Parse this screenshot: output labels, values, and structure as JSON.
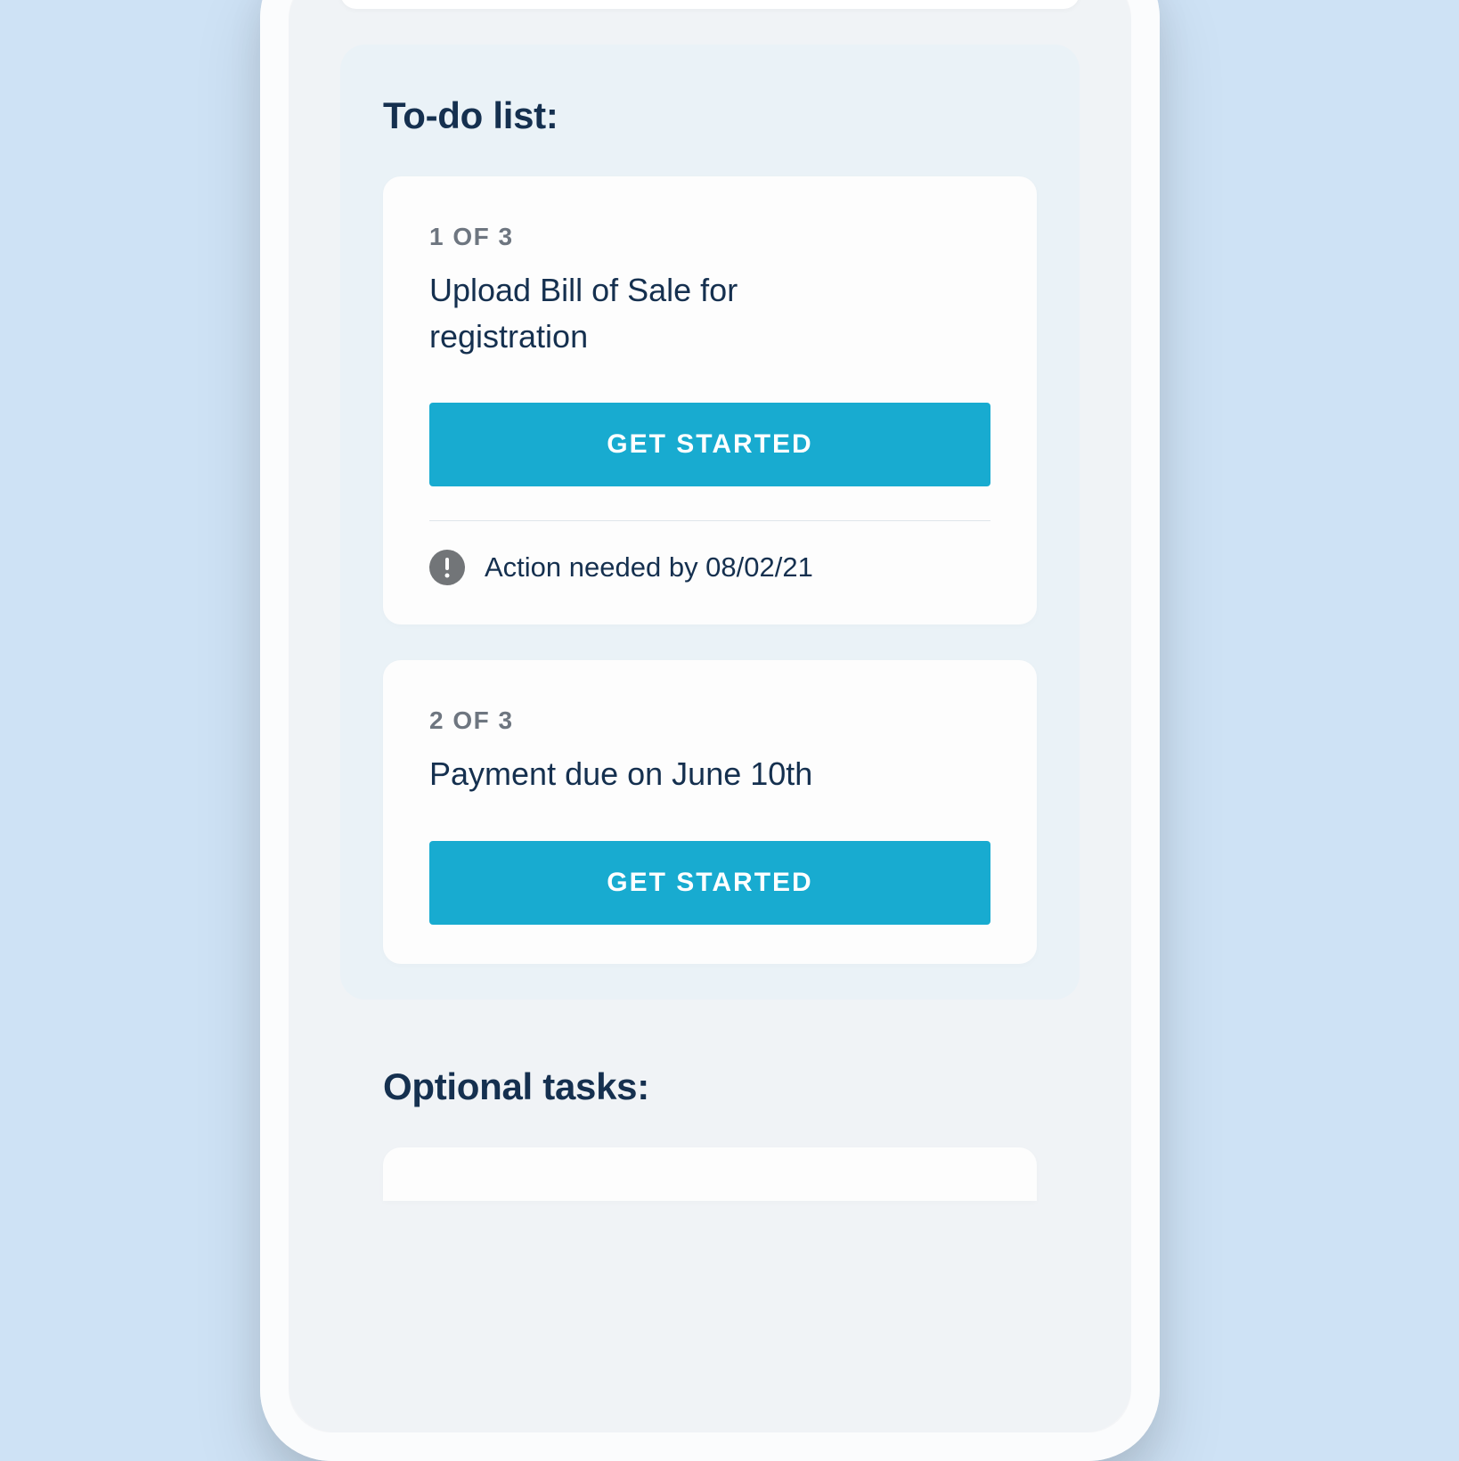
{
  "todo": {
    "heading": "To-do list:",
    "tasks": [
      {
        "counter": "1 OF 3",
        "title": "Upload Bill of Sale for registration",
        "cta": "GET STARTED",
        "action_needed": "Action needed by 08/02/21"
      },
      {
        "counter": "2 OF 3",
        "title": "Payment due on June 10th",
        "cta": "GET STARTED"
      }
    ]
  },
  "optional": {
    "heading": "Optional tasks:"
  },
  "colors": {
    "background": "#cee2f5",
    "accent": "#18abd0",
    "text_primary": "#15304f",
    "text_muted": "#6e7680"
  }
}
